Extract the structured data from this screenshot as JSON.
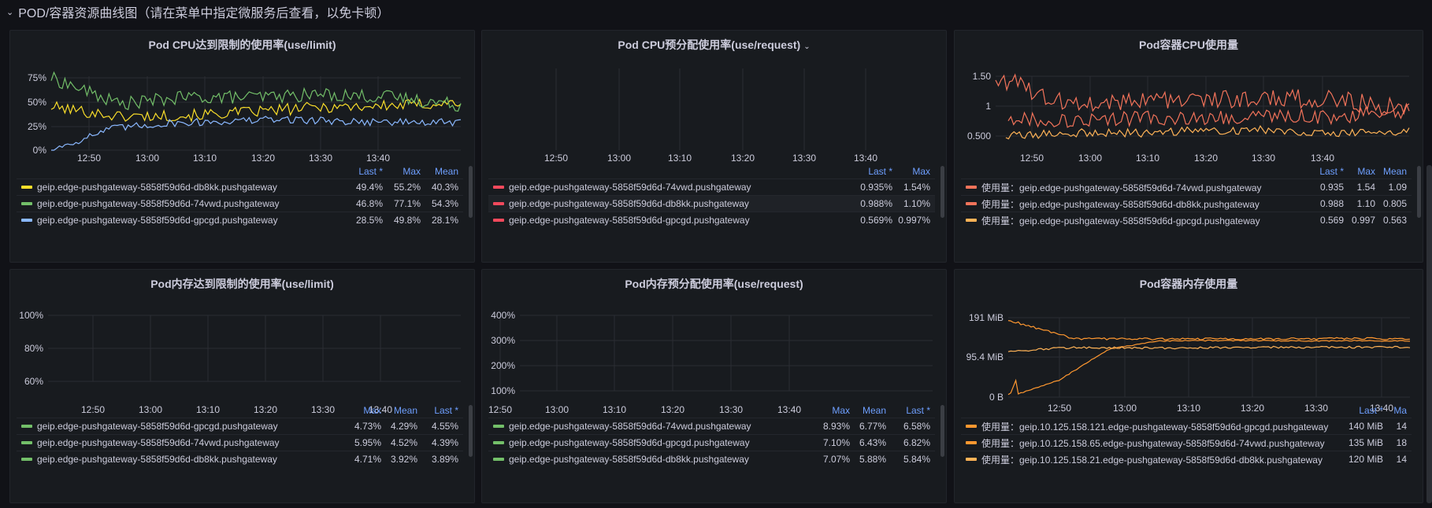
{
  "row_title": "POD/容器资源曲线图（请在菜单中指定微服务后查看，以免卡顿）",
  "panels": {
    "p1": {
      "title": "Pod CPU达到限制的使用率(use/limit)",
      "yticks": [
        "75%",
        "50%",
        "25%",
        "0%"
      ],
      "xticks": [
        "12:50",
        "13:00",
        "13:10",
        "13:20",
        "13:30",
        "13:40"
      ],
      "cols": [
        "Last *",
        "Max",
        "Mean"
      ],
      "rows": [
        {
          "name": "geip.edge-pushgateway-5858f59d6d-db8kk.pushgateway",
          "color": "#fade2a",
          "values": [
            "49.4%",
            "55.2%",
            "40.3%"
          ]
        },
        {
          "name": "geip.edge-pushgateway-5858f59d6d-74vwd.pushgateway",
          "color": "#73bf69",
          "values": [
            "46.8%",
            "77.1%",
            "54.3%"
          ]
        },
        {
          "name": "geip.edge-pushgateway-5858f59d6d-gpcgd.pushgateway",
          "color": "#8ab8ff",
          "values": [
            "28.5%",
            "49.8%",
            "28.1%"
          ]
        }
      ]
    },
    "p2": {
      "title": "Pod CPU预分配使用率(use/request)",
      "dropdown_glyph": "⌄",
      "xticks": [
        "12:50",
        "13:00",
        "13:10",
        "13:20",
        "13:30",
        "13:40"
      ],
      "cols": [
        "Last *",
        "Max"
      ],
      "rows": [
        {
          "name": "geip.edge-pushgateway-5858f59d6d-74vwd.pushgateway",
          "color": "#f2495c",
          "values": [
            "0.935%",
            "1.54%"
          ]
        },
        {
          "name": "geip.edge-pushgateway-5858f59d6d-db8kk.pushgateway",
          "color": "#f2495c",
          "values": [
            "0.988%",
            "1.10%"
          ]
        },
        {
          "name": "geip.edge-pushgateway-5858f59d6d-gpcgd.pushgateway",
          "color": "#f2495c",
          "values": [
            "0.569%",
            "0.997%"
          ]
        }
      ]
    },
    "p3": {
      "title": "Pod容器CPU使用量",
      "yticks": [
        "1.50",
        "1",
        "0.500"
      ],
      "xticks": [
        "12:50",
        "13:00",
        "13:10",
        "13:20",
        "13:30",
        "13:40"
      ],
      "cols": [
        "Last *",
        "Max",
        "Mean"
      ],
      "rows": [
        {
          "name": "使用量：geip.edge-pushgateway-5858f59d6d-74vwd.pushgateway",
          "color": "#f2735a",
          "values": [
            "0.935",
            "1.54",
            "1.09"
          ]
        },
        {
          "name": "使用量：geip.edge-pushgateway-5858f59d6d-db8kk.pushgateway",
          "color": "#f2735a",
          "values": [
            "0.988",
            "1.10",
            "0.805"
          ]
        },
        {
          "name": "使用量：geip.edge-pushgateway-5858f59d6d-gpcgd.pushgateway",
          "color": "#ffb357",
          "values": [
            "0.569",
            "0.997",
            "0.563"
          ]
        }
      ]
    },
    "p4": {
      "title": "Pod内存达到限制的使用率(use/limit)",
      "yticks": [
        "100%",
        "80%",
        "60%"
      ],
      "xticks": [
        "12:50",
        "13:00",
        "13:10",
        "13:20",
        "13:30",
        "13:40"
      ],
      "cols": [
        "Max",
        "Mean",
        "Last *"
      ],
      "rows": [
        {
          "name": "geip.edge-pushgateway-5858f59d6d-gpcgd.pushgateway",
          "color": "#73bf69",
          "values": [
            "4.73%",
            "4.29%",
            "4.55%"
          ]
        },
        {
          "name": "geip.edge-pushgateway-5858f59d6d-74vwd.pushgateway",
          "color": "#73bf69",
          "values": [
            "5.95%",
            "4.52%",
            "4.39%"
          ]
        },
        {
          "name": "geip.edge-pushgateway-5858f59d6d-db8kk.pushgateway",
          "color": "#73bf69",
          "values": [
            "4.71%",
            "3.92%",
            "3.89%"
          ]
        }
      ]
    },
    "p5": {
      "title": "Pod内存预分配使用率(use/request)",
      "yticks": [
        "400%",
        "300%",
        "200%",
        "100%"
      ],
      "xticks": [
        "12:50",
        "13:00",
        "13:10",
        "13:20",
        "13:30",
        "13:40"
      ],
      "cols": [
        "Max",
        "Mean",
        "Last *"
      ],
      "rows": [
        {
          "name": "geip.edge-pushgateway-5858f59d6d-74vwd.pushgateway",
          "color": "#73bf69",
          "values": [
            "8.93%",
            "6.77%",
            "6.58%"
          ]
        },
        {
          "name": "geip.edge-pushgateway-5858f59d6d-gpcgd.pushgateway",
          "color": "#73bf69",
          "values": [
            "7.10%",
            "6.43%",
            "6.82%"
          ]
        },
        {
          "name": "geip.edge-pushgateway-5858f59d6d-db8kk.pushgateway",
          "color": "#73bf69",
          "values": [
            "7.07%",
            "5.88%",
            "5.84%"
          ]
        }
      ]
    },
    "p6": {
      "title": "Pod容器内存使用量",
      "yticks": [
        "191 MiB",
        "95.4 MiB",
        "0 B"
      ],
      "xticks": [
        "12:50",
        "13:00",
        "13:10",
        "13:20",
        "13:30",
        "13:40"
      ],
      "cols": [
        "Last *",
        "Ma"
      ],
      "rows": [
        {
          "name": "使用量：geip.10.125.158.121.edge-pushgateway-5858f59d6d-gpcgd.pushgateway",
          "color": "#ff9830",
          "values": [
            "140 MiB",
            "14"
          ]
        },
        {
          "name": "使用量：geip.10.125.158.65.edge-pushgateway-5858f59d6d-74vwd.pushgateway",
          "color": "#ff9830",
          "values": [
            "135 MiB",
            "18"
          ]
        },
        {
          "name": "使用量：geip.10.125.158.21.edge-pushgateway-5858f59d6d-db8kk.pushgateway",
          "color": "#ffb357",
          "values": [
            "120 MiB",
            "14"
          ]
        }
      ]
    }
  },
  "chart_data": [
    {
      "type": "line",
      "title": "Pod CPU达到限制的使用率(use/limit)",
      "ylim": [
        0,
        80
      ],
      "unit": "%",
      "x": [
        "12:42",
        "12:50",
        "13:00",
        "13:10",
        "13:20",
        "13:30",
        "13:40"
      ],
      "series": [
        {
          "name": "geip.edge-pushgateway-5858f59d6d-db8kk.pushgateway",
          "values": [
            45,
            35,
            36,
            40,
            45,
            46,
            49.4
          ]
        },
        {
          "name": "geip.edge-pushgateway-5858f59d6d-74vwd.pushgateway",
          "values": [
            75,
            48,
            55,
            55,
            58,
            55,
            46.8
          ]
        },
        {
          "name": "geip.edge-pushgateway-5858f59d6d-gpcgd.pushgateway",
          "values": [
            0,
            28,
            30,
            32,
            30,
            30,
            28.5
          ]
        }
      ]
    },
    {
      "type": "line",
      "title": "Pod CPU预分配使用率(use/request)",
      "x": [
        "12:50",
        "13:00",
        "13:10",
        "13:20",
        "13:30",
        "13:40"
      ],
      "series": [
        {
          "name": "geip.edge-pushgateway-5858f59d6d-74vwd.pushgateway",
          "values": []
        },
        {
          "name": "geip.edge-pushgateway-5858f59d6d-db8kk.pushgateway",
          "values": []
        },
        {
          "name": "geip.edge-pushgateway-5858f59d6d-gpcgd.pushgateway",
          "values": []
        }
      ]
    },
    {
      "type": "line",
      "title": "Pod容器CPU使用量",
      "ylim": [
        0.4,
        1.6
      ],
      "x": [
        "12:42",
        "12:50",
        "13:00",
        "13:10",
        "13:20",
        "13:30",
        "13:40"
      ],
      "series": [
        {
          "name": "使用量：geip.edge-pushgateway-5858f59d6d-74vwd.pushgateway",
          "values": [
            1.5,
            1.05,
            1.1,
            1.1,
            1.15,
            1.1,
            0.935
          ]
        },
        {
          "name": "使用量：geip.edge-pushgateway-5858f59d6d-db8kk.pushgateway",
          "values": [
            0.8,
            0.75,
            0.8,
            0.8,
            0.85,
            0.8,
            0.988
          ]
        },
        {
          "name": "使用量：geip.edge-pushgateway-5858f59d6d-gpcgd.pushgateway",
          "values": [
            0.5,
            0.55,
            0.55,
            0.6,
            0.6,
            0.55,
            0.569
          ]
        }
      ]
    },
    {
      "type": "line",
      "title": "Pod内存达到限制的使用率(use/limit)",
      "ylim": [
        50,
        100
      ],
      "x": [
        "12:50",
        "13:00",
        "13:10",
        "13:20",
        "13:30",
        "13:40"
      ],
      "series": [
        {
          "name": "geip.edge-pushgateway-5858f59d6d-gpcgd.pushgateway",
          "values": []
        },
        {
          "name": "geip.edge-pushgateway-5858f59d6d-74vwd.pushgateway",
          "values": []
        },
        {
          "name": "geip.edge-pushgateway-5858f59d6d-db8kk.pushgateway",
          "values": []
        }
      ]
    },
    {
      "type": "line",
      "title": "Pod内存预分配使用率(use/request)",
      "ylim": [
        100,
        400
      ],
      "x": [
        "12:50",
        "13:00",
        "13:10",
        "13:20",
        "13:30",
        "13:40"
      ],
      "series": [
        {
          "name": "geip.edge-pushgateway-5858f59d6d-74vwd.pushgateway",
          "values": []
        },
        {
          "name": "geip.edge-pushgateway-5858f59d6d-gpcgd.pushgateway",
          "values": []
        },
        {
          "name": "geip.edge-pushgateway-5858f59d6d-db8kk.pushgateway",
          "values": []
        }
      ]
    },
    {
      "type": "line",
      "title": "Pod容器内存使用量",
      "ylim": [
        0,
        191
      ],
      "unit": "MiB",
      "x": [
        "12:42",
        "12:50",
        "13:00",
        "13:10",
        "13:20",
        "13:30",
        "13:40"
      ],
      "series": [
        {
          "name": "使用量：geip.10.125.158.121.edge-pushgateway-5858f59d6d-gpcgd.pushgateway",
          "values": [
            185,
            140,
            140,
            140,
            140,
            141,
            140
          ]
        },
        {
          "name": "使用量：geip.10.125.158.65.edge-pushgateway-5858f59d6d-74vwd.pushgateway",
          "values": [
            0,
            130,
            135,
            135,
            136,
            136,
            135
          ]
        },
        {
          "name": "使用量：geip.10.125.158.21.edge-pushgateway-5858f59d6d-db8kk.pushgateway",
          "values": [
            110,
            120,
            118,
            119,
            120,
            120,
            120
          ]
        }
      ]
    }
  ]
}
